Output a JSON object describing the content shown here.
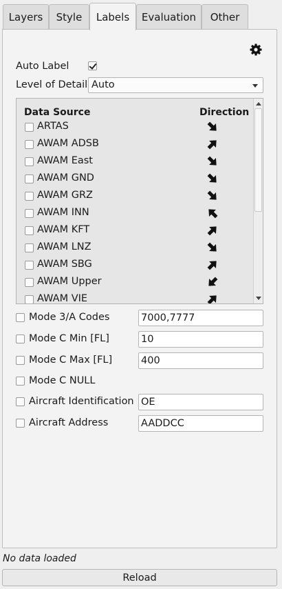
{
  "tabs": [
    {
      "label": "Layers",
      "active": false
    },
    {
      "label": "Style",
      "active": false
    },
    {
      "label": "Labels",
      "active": true
    },
    {
      "label": "Evaluation",
      "active": false
    },
    {
      "label": "Other",
      "active": false
    }
  ],
  "settings_icon": "gear-icon",
  "auto_label": {
    "label": "Auto Label",
    "checked": true
  },
  "level_of_detail": {
    "label": "Level of Detail",
    "value": "Auto"
  },
  "data_source_list": {
    "header_source": "Data Source",
    "header_direction": "Direction",
    "items": [
      {
        "name": "ARTAS",
        "checked": false,
        "direction": "down-right"
      },
      {
        "name": "AWAM ADSB",
        "checked": false,
        "direction": "up-right"
      },
      {
        "name": "AWAM East",
        "checked": false,
        "direction": "down-right"
      },
      {
        "name": "AWAM GND",
        "checked": false,
        "direction": "down-right"
      },
      {
        "name": "AWAM GRZ",
        "checked": false,
        "direction": "down-right"
      },
      {
        "name": "AWAM INN",
        "checked": false,
        "direction": "up-left"
      },
      {
        "name": "AWAM KFT",
        "checked": false,
        "direction": "up-right"
      },
      {
        "name": "AWAM LNZ",
        "checked": false,
        "direction": "down-right"
      },
      {
        "name": "AWAM SBG",
        "checked": false,
        "direction": "up-right"
      },
      {
        "name": "AWAM Upper",
        "checked": false,
        "direction": "down-left"
      },
      {
        "name": "AWAM VIE",
        "checked": false,
        "direction": "up-right"
      }
    ]
  },
  "filters": [
    {
      "label": "Mode 3/A Codes",
      "checked": false,
      "value": "7000,7777"
    },
    {
      "label": "Mode C Min [FL]",
      "checked": false,
      "value": "10"
    },
    {
      "label": "Mode C Max [FL]",
      "checked": false,
      "value": "400"
    },
    {
      "label": "Mode C NULL",
      "checked": false
    },
    {
      "label": "Aircraft Identification",
      "checked": false,
      "value": "OE"
    },
    {
      "label": "Aircraft Address",
      "checked": false,
      "value": "AADDCC"
    }
  ],
  "status_text": "No data loaded",
  "reload_label": "Reload"
}
